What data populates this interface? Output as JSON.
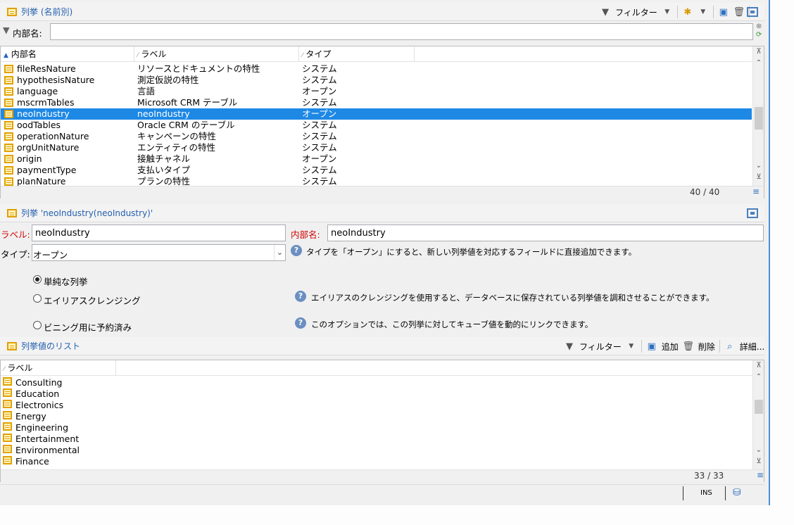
{
  "top_panel": {
    "title": "列挙 (名前別)",
    "filter_label": "フィルター",
    "search_label": "内部名:",
    "search_value": "",
    "columns": [
      "内部名",
      "ラベル",
      "タイプ"
    ],
    "rows": [
      {
        "name": "fileResNature",
        "label": "リソースとドキュメントの特性",
        "type": "システム"
      },
      {
        "name": "hypothesisNature",
        "label": "測定仮説の特性",
        "type": "システム"
      },
      {
        "name": "language",
        "label": "言語",
        "type": "オープン"
      },
      {
        "name": "mscrmTables",
        "label": "Microsoft CRM テーブル",
        "type": "システム"
      },
      {
        "name": "neoIndustry",
        "label": "neoIndustry",
        "type": "オープン"
      },
      {
        "name": "oodTables",
        "label": "Oracle CRM のテーブル",
        "type": "システム"
      },
      {
        "name": "operationNature",
        "label": "キャンペーンの特性",
        "type": "システム"
      },
      {
        "name": "orgUnitNature",
        "label": "エンティティの特性",
        "type": "システム"
      },
      {
        "name": "origin",
        "label": "接触チャネル",
        "type": "オープン"
      },
      {
        "name": "paymentType",
        "label": "支払いタイプ",
        "type": "システム"
      },
      {
        "name": "planNature",
        "label": "プランの特性",
        "type": "システム"
      }
    ],
    "selected_index": 4,
    "count": "40 / 40"
  },
  "detail_panel": {
    "title": "列挙 'neoIndustry(neoIndustry)'",
    "label_caption": "ラベル:",
    "label_value": "neoIndustry",
    "internal_caption": "内部名:",
    "internal_value": "neoIndustry",
    "type_caption": "タイプ:",
    "type_value": "オープン",
    "type_help": "タイプを「オープン」にすると、新しい列挙値を対応するフィールドに直接追加できます。",
    "options": [
      {
        "label": "単純な列挙",
        "checked": true,
        "help": ""
      },
      {
        "label": "エイリアスクレンジング",
        "checked": false,
        "help": "エイリアスのクレンジングを使用すると、データベースに保存されている列挙値を調和させることができます。"
      },
      {
        "label": "ビニング用に予約済み",
        "checked": false,
        "help": "このオプションでは、この列挙に対してキューブ値を動的にリンクできます。"
      }
    ]
  },
  "values_panel": {
    "title": "列挙値のリスト",
    "filter_label": "フィルター",
    "add_label": "追加",
    "delete_label": "削除",
    "detail_label": "詳細...",
    "column": "ラベル",
    "rows": [
      "Consulting",
      "Education",
      "Electronics",
      "Energy",
      "Engineering",
      "Entertainment",
      "Environmental",
      "Finance"
    ],
    "count": "33 / 33"
  },
  "status": {
    "mode": "INS"
  }
}
